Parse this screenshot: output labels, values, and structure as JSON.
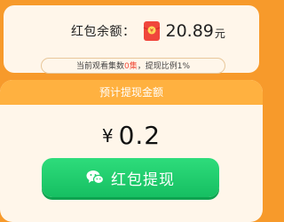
{
  "balance": {
    "label": "红包余额：",
    "amount": "20.89",
    "unit": "元",
    "icon": "red-packet-icon",
    "icon_color": "#f0463c"
  },
  "progress": {
    "prefix": "当前观看集数",
    "count": "0集",
    "suffix": "，提现比例1%"
  },
  "withdraw": {
    "header": "预计提现金额",
    "currency": "¥",
    "amount": "0.2",
    "button_label": "红包提现",
    "button_icon": "wechat-icon"
  },
  "colors": {
    "background": "#f79a2b",
    "card": "#fff6ea",
    "header": "#ffb140",
    "button": "#1fcf6e",
    "highlight": "#f04d3a"
  }
}
